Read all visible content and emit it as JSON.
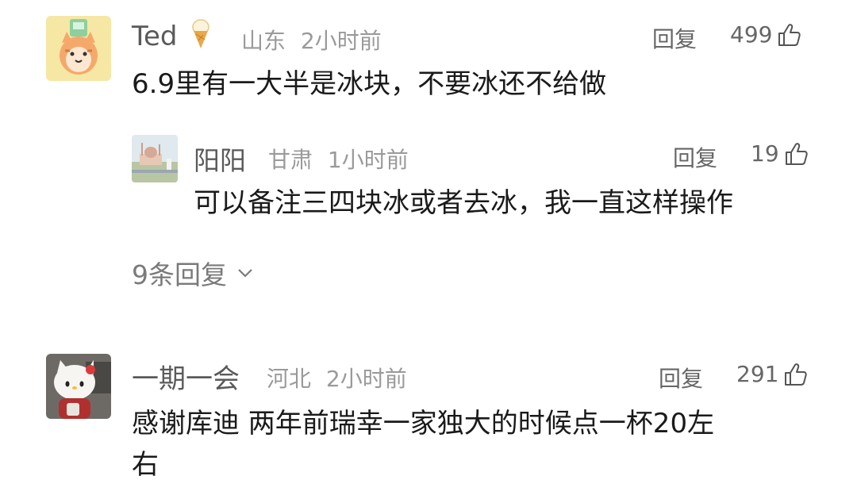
{
  "comments": [
    {
      "user": "Ted",
      "badge_icon": "ice-cream-icon",
      "location": "山东",
      "time": "2小时前",
      "reply_label": "回复",
      "likes": "499",
      "text": "6.9里有一大半是冰块，不要冰还不给做",
      "sub_reply": {
        "user": "阳阳",
        "location": "甘肃",
        "time": "1小时前",
        "reply_label": "回复",
        "likes": "19",
        "text": "可以备注三四块冰或者去冰，我一直这样操作"
      },
      "more_replies": "9条回复"
    },
    {
      "user": "一期一会",
      "location": "河北",
      "time": "2小时前",
      "reply_label": "回复",
      "likes": "291",
      "text_line1": "感谢库迪 两年前瑞幸一家独大的时候点一杯20左",
      "text_line2": "右"
    }
  ],
  "colors": {
    "name": "#5a5a5a",
    "meta": "#9a9a9a",
    "text": "#1a1a1a"
  }
}
